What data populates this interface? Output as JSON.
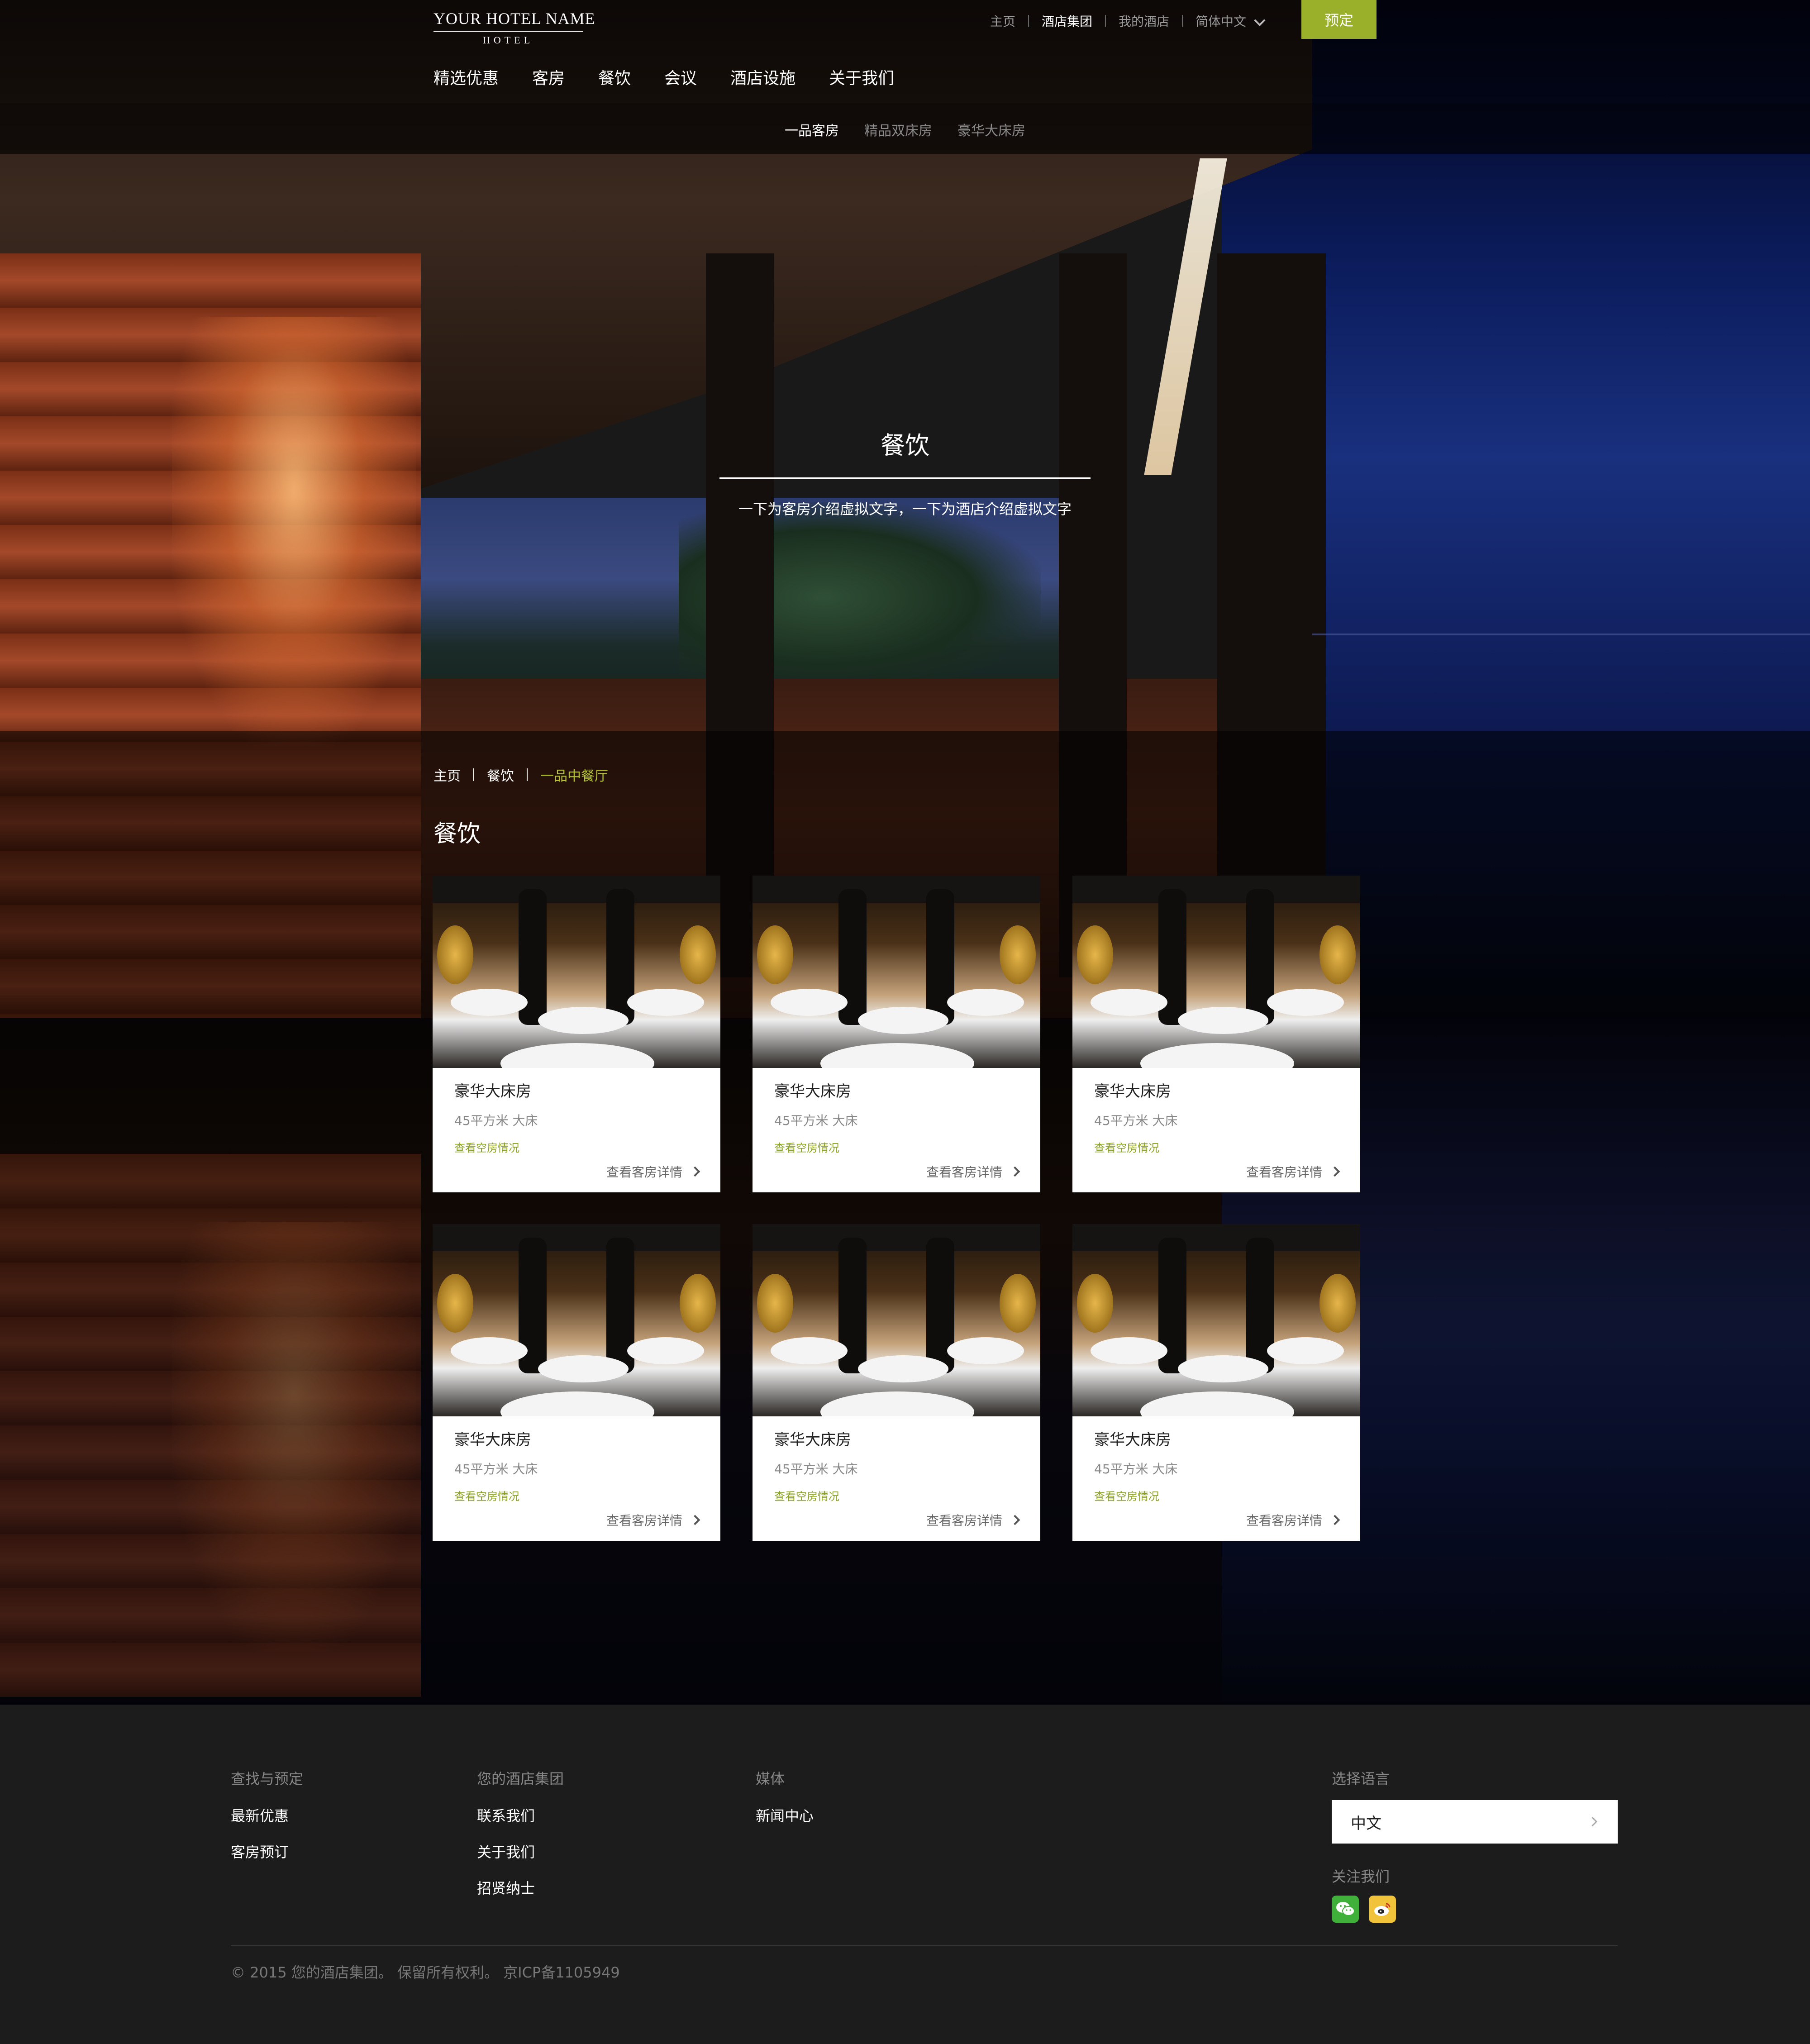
{
  "brand": {
    "name": "YOUR HOTEL NAME",
    "sub": "HOTEL"
  },
  "util_nav": {
    "items": [
      {
        "label": "主页",
        "active": false
      },
      {
        "label": "酒店集团",
        "active": true
      },
      {
        "label": "我的酒店",
        "active": false
      },
      {
        "label": "简体中文",
        "active": false,
        "dropdown": true
      }
    ],
    "book_label": "预定",
    "accent_color": "#9ab02a"
  },
  "main_nav": {
    "items": [
      "精选优惠",
      "客房",
      "餐饮",
      "会议",
      "酒店设施",
      "关于我们"
    ]
  },
  "sub_nav": {
    "items": [
      {
        "label": "一品客房",
        "active": true
      },
      {
        "label": "精品双床房",
        "active": false
      },
      {
        "label": "豪华大床房",
        "active": false
      }
    ]
  },
  "hero": {
    "title": "餐饮",
    "description": "一下为客房介绍虚拟文字，一下为酒店介绍虚拟文字"
  },
  "breadcrumb": {
    "items": [
      "主页",
      "餐饮",
      "一品中餐厅"
    ]
  },
  "section": {
    "heading": "餐饮"
  },
  "cards": [
    {
      "title": "豪华大床房",
      "meta": "45平方米   大床",
      "availability": "查看空房情况",
      "link": "查看客房详情"
    },
    {
      "title": "豪华大床房",
      "meta": "45平方米   大床",
      "availability": "查看空房情况",
      "link": "查看客房详情"
    },
    {
      "title": "豪华大床房",
      "meta": "45平方米   大床",
      "availability": "查看空房情况",
      "link": "查看客房详情"
    },
    {
      "title": "豪华大床房",
      "meta": "45平方米   大床",
      "availability": "查看空房情况",
      "link": "查看客房详情"
    },
    {
      "title": "豪华大床房",
      "meta": "45平方米   大床",
      "availability": "查看空房情况",
      "link": "查看客房详情"
    },
    {
      "title": "豪华大床房",
      "meta": "45平方米   大床",
      "availability": "查看空房情况",
      "link": "查看客房详情"
    }
  ],
  "footer": {
    "col1": {
      "heading": "查找与预定",
      "links": [
        "最新优惠",
        "客房预订"
      ]
    },
    "col2": {
      "heading": "您的酒店集团",
      "links": [
        "联系我们",
        "关于我们",
        "招贤纳士"
      ]
    },
    "col3": {
      "heading": "媒体",
      "links": [
        "新闻中心"
      ]
    },
    "language": {
      "heading": "选择语言",
      "value": "中文"
    },
    "follow": {
      "heading": "关注我们",
      "icons": [
        "wechat-icon",
        "weibo-icon"
      ]
    },
    "copyright": "© 2015 您的酒店集团。 保留所有权利。 京ICP备1105949"
  }
}
